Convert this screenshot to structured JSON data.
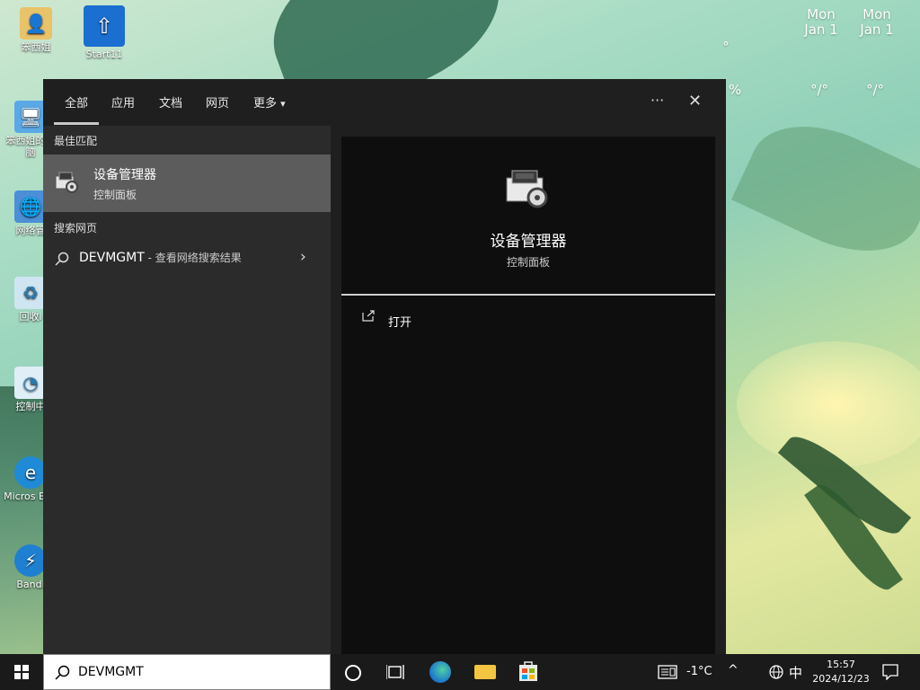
{
  "desktop": {
    "icons": [
      {
        "label": "笨西姐",
        "icon": "user-folder-icon"
      },
      {
        "label": "Start11",
        "icon": "start11-icon"
      },
      {
        "label": "笨西姐的电脑",
        "icon": "computer-icon"
      },
      {
        "label": "网络管",
        "icon": "network-icon"
      },
      {
        "label": "回收i",
        "icon": "recycle-bin-icon"
      },
      {
        "label": "控制中",
        "icon": "control-panel-icon"
      },
      {
        "label": "Micros Edg",
        "icon": "edge-icon"
      },
      {
        "label": "Bandi",
        "icon": "bandizip-icon"
      }
    ]
  },
  "weather": {
    "days": [
      {
        "day": "Mon",
        "date": "Jan 1",
        "temp": "°/°"
      },
      {
        "day": "Mon",
        "date": "Jan 1",
        "temp": "°/°"
      }
    ],
    "humidity": "%",
    "deg_mark": "°"
  },
  "search_menu": {
    "tabs": [
      "全部",
      "应用",
      "文档",
      "网页",
      "更多"
    ],
    "more_arrow": "▾",
    "ellipsis": "···",
    "close": "✕",
    "best_match_header": "最佳匹配",
    "best_match": {
      "name": "设备管理器",
      "sub": "控制面板"
    },
    "search_web_header": "搜索网页",
    "web_query": "DEVMGMT",
    "web_desc": " - 查看网络搜索结果",
    "web_chevron": "›",
    "detail": {
      "name": "设备管理器",
      "sub": "控制面板",
      "open_action": "打开"
    }
  },
  "taskbar": {
    "search_value": "DEVMGMT",
    "weather_temp": "-1°C",
    "tray_up": "^",
    "ime": "中",
    "time": "15:57",
    "date": "2024/12/23"
  },
  "colors": {
    "menu_bg": "#1f1f1f",
    "left_bg": "#2b2b2b",
    "detail_bg": "#0e0e0e",
    "highlight": "#5c5c5c",
    "taskbar": "#1a1a1a"
  }
}
